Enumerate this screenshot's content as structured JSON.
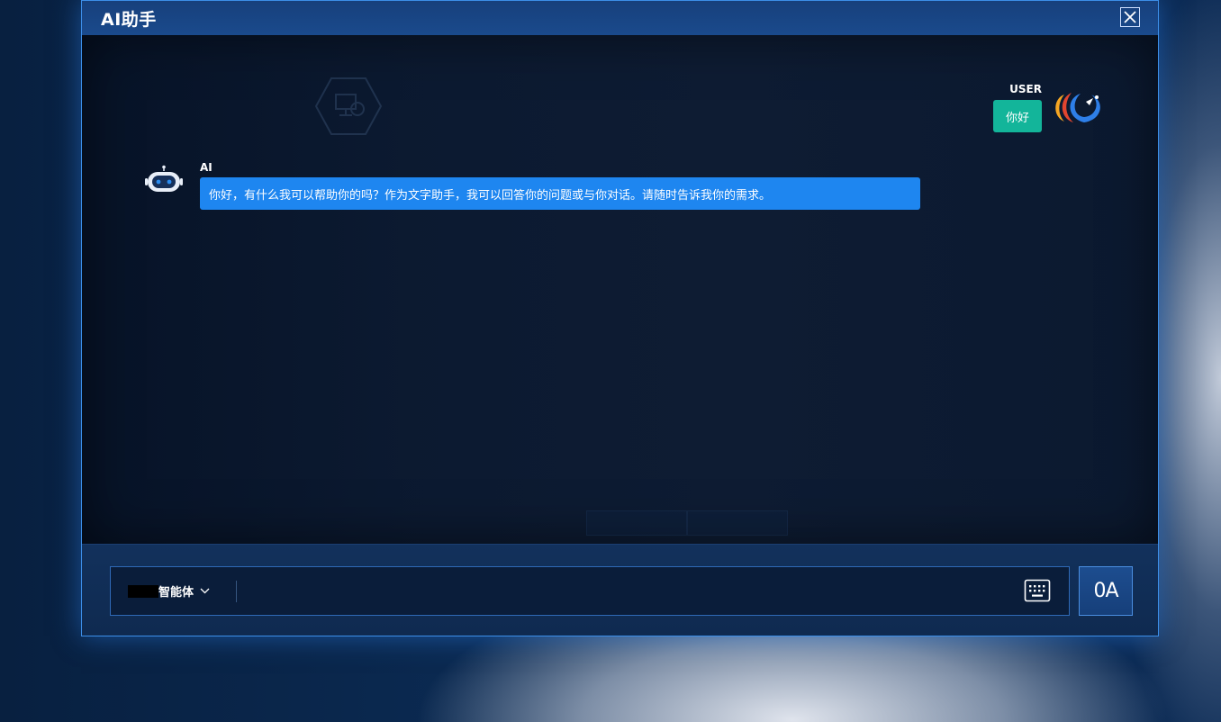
{
  "dialog": {
    "title": "AI助手"
  },
  "chat": {
    "user": {
      "name": "USER",
      "message": "你好"
    },
    "ai": {
      "name": "AI",
      "message": "你好，有什么我可以帮助你的吗？作为文字助手，我可以回答你的问题或与你对话。请随时告诉我你的需求。"
    }
  },
  "input": {
    "agent_label": "智能体",
    "placeholder": "",
    "send_icon_text": "0A"
  },
  "colors": {
    "accent_blue": "#1e86f0",
    "user_bubble": "#13b59a",
    "dialog_border": "#3c8ee8"
  }
}
